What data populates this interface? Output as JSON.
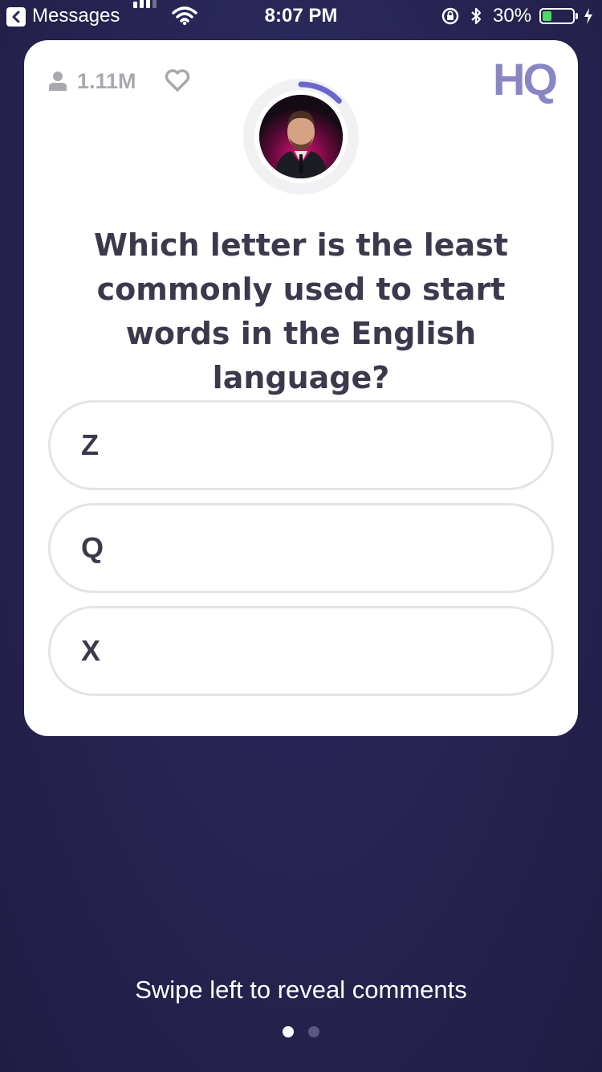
{
  "status_bar": {
    "back_app": "Messages",
    "time": "8:07 PM",
    "battery_percent": "30%",
    "battery_level": 0.3,
    "signal_bars": 3,
    "battery_color": "#4cd964"
  },
  "card": {
    "viewer_count": "1.11M",
    "logo": "HQ",
    "timer_progress": 0.13,
    "icons": [
      "user-icon",
      "heart-icon"
    ],
    "question": "Which letter is the least commonly used to start words in the English language?",
    "answers": [
      {
        "label": "Z"
      },
      {
        "label": "Q"
      },
      {
        "label": "X"
      }
    ]
  },
  "footer": {
    "swipe_hint": "Swipe left to reveal comments",
    "pages": 2,
    "active_page": 1
  },
  "colors": {
    "background": "#262350",
    "accent": "#6b67cf",
    "logo": "#8986c5"
  }
}
